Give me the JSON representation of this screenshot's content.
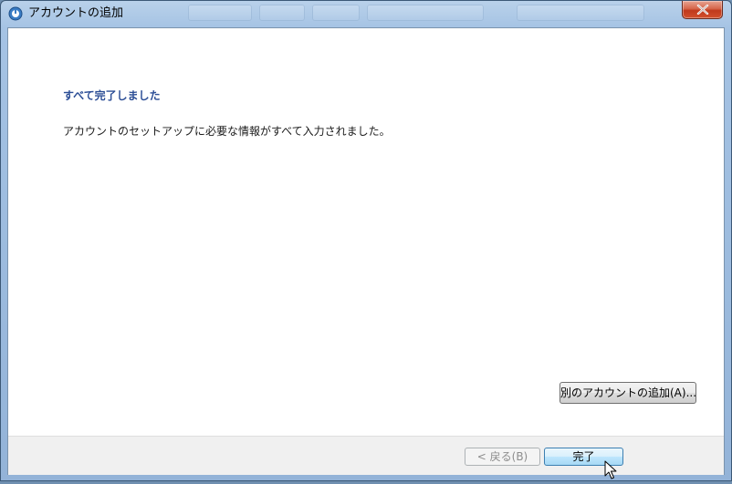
{
  "window": {
    "title": "アカウントの追加"
  },
  "content": {
    "heading": "すべて完了しました",
    "message": "アカウントのセットアップに必要な情報がすべて入力されました。",
    "add_account_button": "別のアカウントの追加(A)..."
  },
  "footer": {
    "back_button": "< 戻る(B)",
    "finish_button": "完了"
  },
  "colors": {
    "heading": "#2c4e96",
    "titlebar": "#a5c3e4",
    "close": "#c0391c"
  },
  "icons": {
    "app": "outlook-icon",
    "close": "close-icon",
    "cursor": "mouse-pointer-icon"
  }
}
